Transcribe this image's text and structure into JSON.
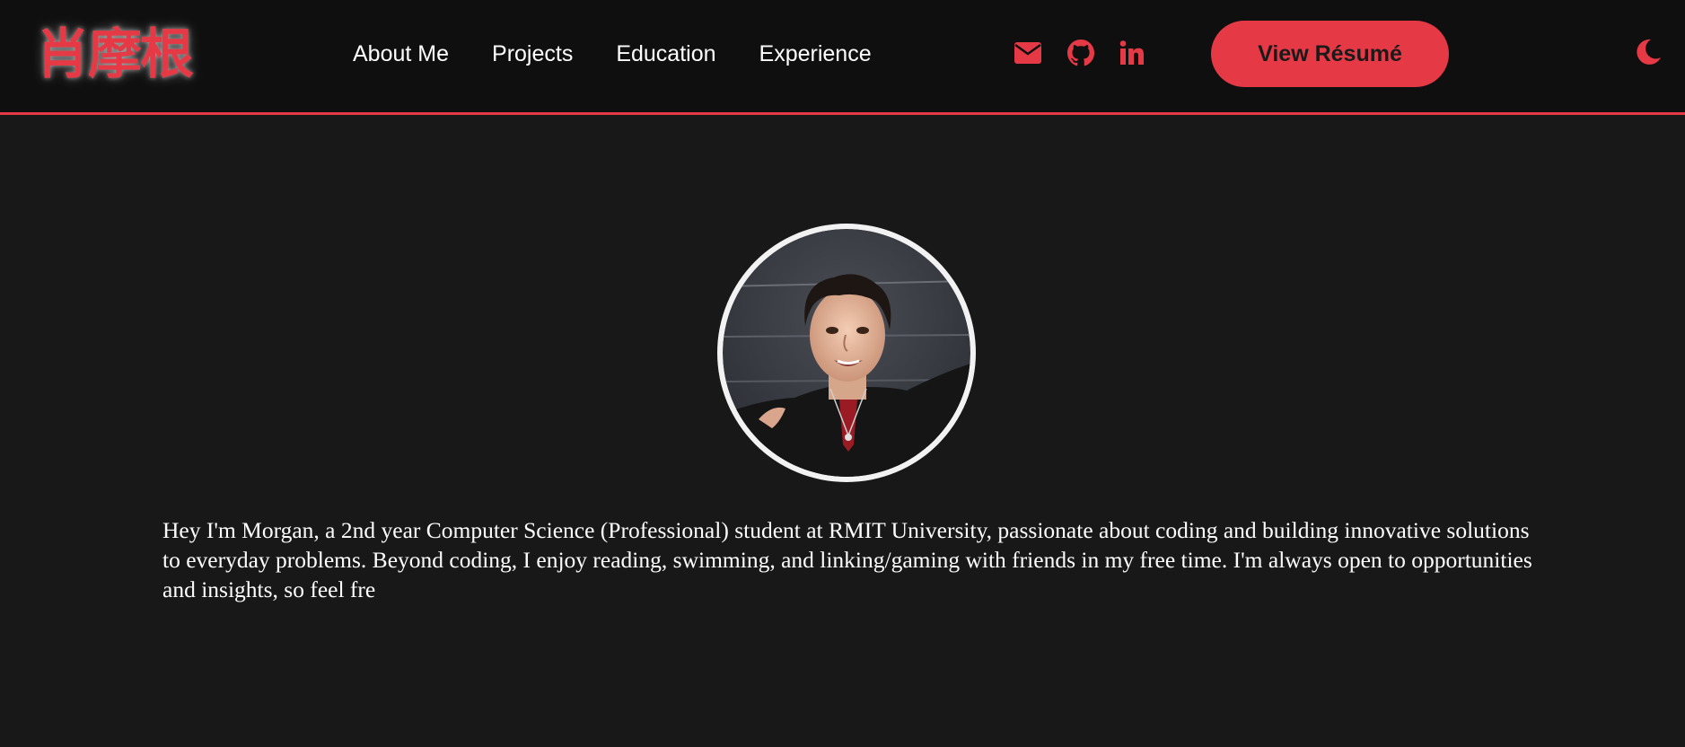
{
  "logo": {
    "text": "肖摩根"
  },
  "nav": {
    "links": [
      {
        "label": "About Me"
      },
      {
        "label": "Projects"
      },
      {
        "label": "Education"
      },
      {
        "label": "Experience"
      }
    ]
  },
  "social": {
    "icons": [
      "envelope-icon",
      "github-icon",
      "linkedin-icon"
    ]
  },
  "resume_button": {
    "label": "View Résumé"
  },
  "theme_toggle": {
    "icon": "moon-icon"
  },
  "profile": {
    "bio": "Hey I'm Morgan, a 2nd year Computer Science (Professional) student at RMIT University, passionate about coding and building innovative solutions to everyday problems. Beyond coding, I enjoy reading, swimming, and linking/gaming with friends in my free time. I'm always open to opportunities and insights, so feel fre"
  },
  "colors": {
    "accent": "#e63946",
    "navbar_bg": "#0f0f0f",
    "page_bg": "#181818",
    "text": "#ffffff"
  }
}
